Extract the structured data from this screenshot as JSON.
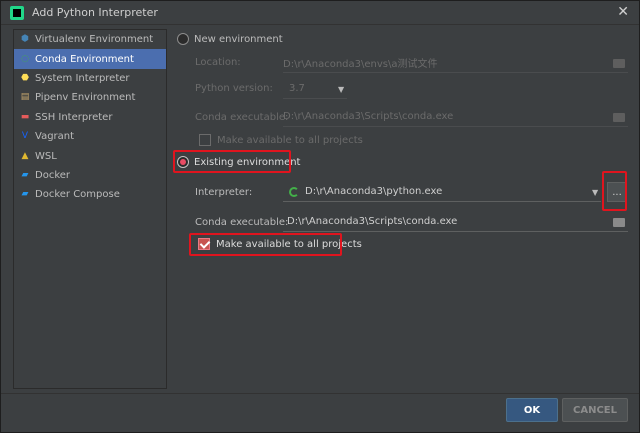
{
  "window": {
    "title": "Add Python Interpreter"
  },
  "sidebar": {
    "items": [
      {
        "label": "Virtualenv Environment",
        "icon": "virtualenv-icon",
        "color": "#4584b6"
      },
      {
        "label": "Conda Environment",
        "icon": "conda-icon",
        "color": "#43b049",
        "selected": true
      },
      {
        "label": "System Interpreter",
        "icon": "python-icon",
        "color": "#ffde57"
      },
      {
        "label": "Pipenv Environment",
        "icon": "pipenv-icon",
        "color": "#c9a96e"
      },
      {
        "label": "SSH Interpreter",
        "icon": "ssh-icon",
        "color": "#e55b5b"
      },
      {
        "label": "Vagrant",
        "icon": "vagrant-icon",
        "color": "#1563ff"
      },
      {
        "label": "WSL",
        "icon": "linux-icon",
        "color": "#e0b830"
      },
      {
        "label": "Docker",
        "icon": "docker-icon",
        "color": "#2496ed"
      },
      {
        "label": "Docker Compose",
        "icon": "docker-compose-icon",
        "color": "#2496ed"
      }
    ]
  },
  "new_env": {
    "label": "New environment",
    "location_label": "Location:",
    "location_value": "D:\\r\\Anaconda3\\envs\\a测试文件",
    "python_version_label": "Python version:",
    "python_version_value": "3.7",
    "conda_exec_label": "Conda executable:",
    "conda_exec_value": "D:\\r\\Anaconda3\\Scripts\\conda.exe",
    "make_available_label": "Make available to all projects"
  },
  "existing_env": {
    "label": "Existing environment",
    "interpreter_label": "Interpreter:",
    "interpreter_value": "D:\\r\\Anaconda3\\python.exe",
    "more_label": "...",
    "conda_exec_label": "Conda executable:",
    "conda_exec_value": "D:\\r\\Anaconda3\\Scripts\\conda.exe",
    "make_available_label": "Make available to all projects"
  },
  "buttons": {
    "ok": "OK",
    "cancel": "CANCEL"
  },
  "colors": {
    "accent": "#4b6eaf",
    "highlight": "#e0141e",
    "radio_selected": "#e84d65",
    "ok_button": "#365880"
  }
}
